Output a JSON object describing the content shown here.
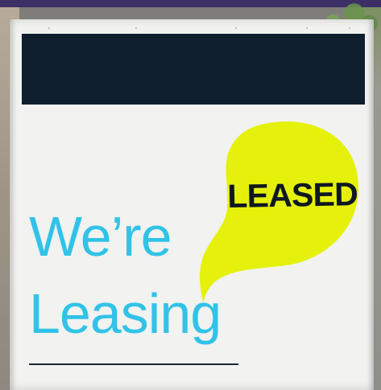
{
  "sign": {
    "status_sticker": "LEASED",
    "headline_line_1": "We’re",
    "headline_line_2": "Leasing"
  },
  "colors": {
    "sign_background": "#f2f2f0",
    "redaction_box": "#0f1f2e",
    "speech_bubble": "#e5f10a",
    "headline_text": "#31c3e7",
    "sticker_text": "#0f1720"
  }
}
